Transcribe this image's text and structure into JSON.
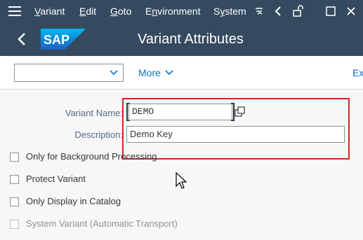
{
  "menubar": {
    "items": [
      {
        "text": "Variant",
        "underline": "V",
        "rest": "ariant"
      },
      {
        "text": "Edit",
        "underline": "E",
        "rest": "dit"
      },
      {
        "text": "Goto",
        "underline": "G",
        "rest": "oto"
      },
      {
        "text": "Environment",
        "underline": "n",
        "pre": "E",
        "rest": "vironment"
      },
      {
        "text": "System",
        "underline": "y",
        "pre": "S",
        "rest": "stem"
      }
    ],
    "icons": [
      "menu-icon",
      "more-icon",
      "back-arrow-icon",
      "unlock-icon",
      "restore-window-icon",
      "close-icon"
    ]
  },
  "titlebar": {
    "logo_text": "SAP",
    "title": "Variant Attributes"
  },
  "toolbar": {
    "select_value": "",
    "more_label": "More",
    "exit_label": "Ex"
  },
  "form": {
    "variant_name_label": "Variant Name:",
    "variant_name_value": "DEMO",
    "description_label": "Description:",
    "description_value": "Demo Key"
  },
  "checkboxes": [
    {
      "label": "Only for Background Processing",
      "checked": false,
      "enabled": true
    },
    {
      "label": "Protect Variant",
      "checked": false,
      "enabled": true
    },
    {
      "label": "Only Display in Catalog",
      "checked": false,
      "enabled": true
    },
    {
      "label": "System Variant (Automatic Transport)",
      "checked": false,
      "enabled": false
    }
  ],
  "colors": {
    "shell": "#354a5f",
    "link": "#0a6ed1",
    "highlight": "#d0262d",
    "background": "#f7f7f7"
  }
}
